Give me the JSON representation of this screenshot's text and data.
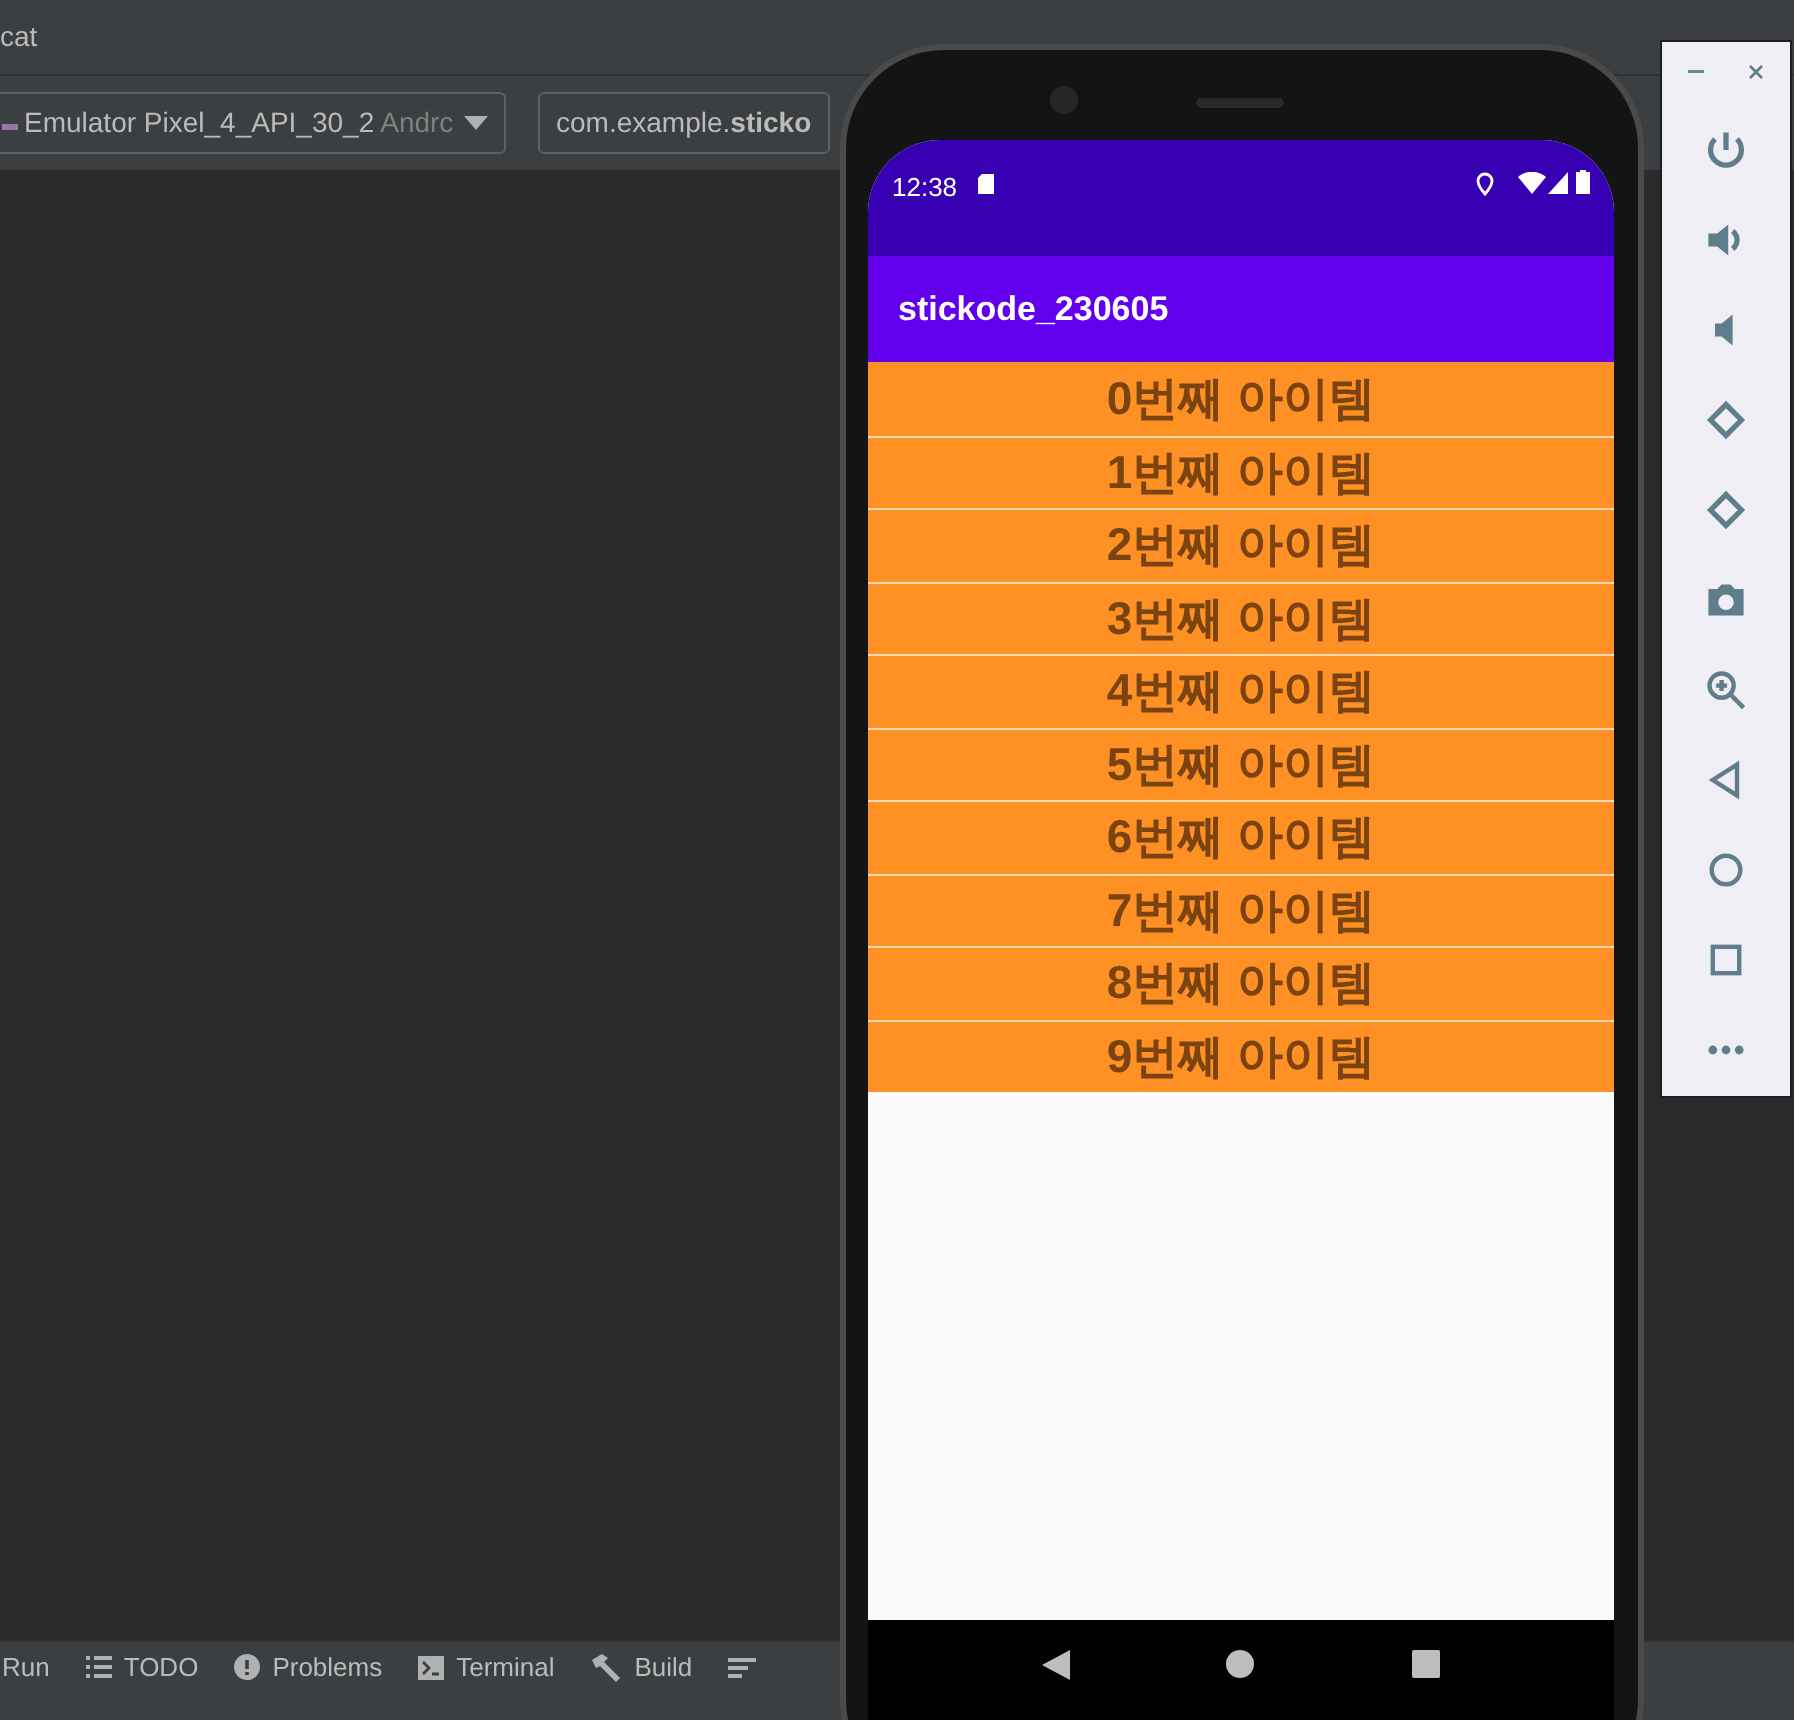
{
  "ide": {
    "tool_window_title": "cat",
    "device_dropdown": {
      "value": "Emulator Pixel_4_API_30_2",
      "suffix": "Andrc"
    },
    "process_field": {
      "value": "com.example.**sticko**"
    }
  },
  "bottom_tabs": [
    {
      "label": "Run",
      "kind": "plain"
    },
    {
      "label": "TODO",
      "kind": "list"
    },
    {
      "label": "Problems",
      "kind": "problems"
    },
    {
      "label": "Terminal",
      "kind": "terminal"
    },
    {
      "label": "Build",
      "kind": "build"
    }
  ],
  "phone": {
    "status_bar": {
      "time": "12:38"
    },
    "app_bar": {
      "title": "stickode_230605"
    },
    "items": [
      {
        "label": "0번째 아이템"
      },
      {
        "label": "1번째 아이템"
      },
      {
        "label": "2번째 아이템"
      },
      {
        "label": "3번째 아이템"
      },
      {
        "label": "4번째 아이템"
      },
      {
        "label": "5번째 아이템"
      },
      {
        "label": "6번째 아이템"
      },
      {
        "label": "7번째 아이템"
      },
      {
        "label": "8번째 아이템"
      },
      {
        "label": "9번째 아이템"
      }
    ]
  }
}
